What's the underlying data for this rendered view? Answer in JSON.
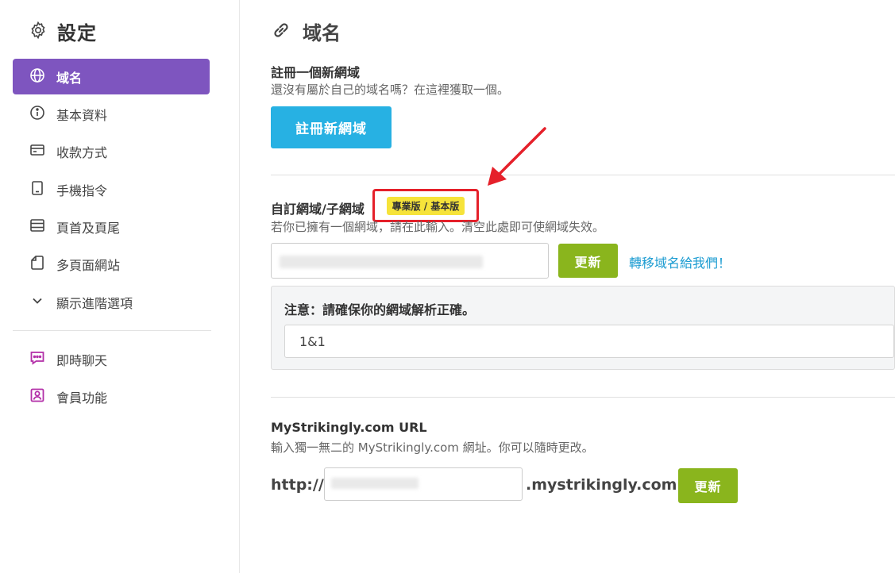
{
  "sidebar": {
    "title": "設定",
    "icons": {
      "title": "gear-icon"
    },
    "items": [
      {
        "label": "域名",
        "icon": "globe-icon",
        "active": true
      },
      {
        "label": "基本資料",
        "icon": "info-icon"
      },
      {
        "label": "收款方式",
        "icon": "card-icon"
      },
      {
        "label": "手機指令",
        "icon": "tablet-icon"
      },
      {
        "label": "頁首及頁尾",
        "icon": "layout-icon"
      },
      {
        "label": "多頁面網站",
        "icon": "page-icon"
      },
      {
        "label": "顯示進階選項",
        "icon": "chevron-down-icon"
      }
    ],
    "extras": [
      {
        "label": "即時聊天",
        "icon": "chat-icon"
      },
      {
        "label": "會員功能",
        "icon": "member-icon"
      }
    ]
  },
  "main": {
    "title": "域名",
    "title_icon": "link-icon",
    "register": {
      "heading": "註冊一個新網域",
      "desc": "還沒有屬於自己的域名嗎？在這裡獲取一個。",
      "button": "註冊新網域"
    },
    "custom": {
      "heading": "自訂網域/子網域",
      "badge": "專業版 / 基本版",
      "desc": "若你已擁有一個網域，請在此輸入。清空此處即可使網域失效。",
      "update_button": "更新",
      "transfer_link": "轉移域名給我們！",
      "note_title": "注意：請確保你的網域解析正確。",
      "registrar_value": "1&1"
    },
    "mystrikingly": {
      "heading": "MyStrikingly.com URL",
      "desc": "輸入獨一無二的 MyStrikingly.com 網址。你可以隨時更改。",
      "prefix": "http://",
      "suffix": ".mystrikingly.com",
      "update_button": "更新"
    }
  },
  "colors": {
    "active_nav": "#7e55bf",
    "primary_blue": "#27b1e3",
    "green": "#8ab51d",
    "badge_yellow": "#f6e33a",
    "annotation_red": "#e5202a",
    "link": "#1a9bd1",
    "chat_icon": "#b32fa8"
  }
}
